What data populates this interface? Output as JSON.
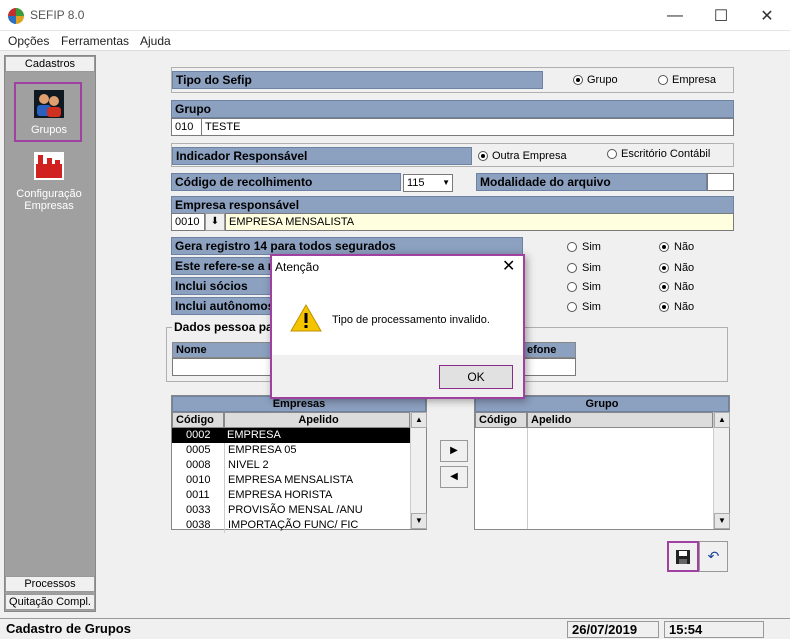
{
  "window": {
    "title": "SEFIP 8.0",
    "minimize": "—",
    "maximize": "☐",
    "close": "✕"
  },
  "menu": [
    "Opções",
    "Ferramentas",
    "Ajuda"
  ],
  "sidebar": {
    "top_tab": "Cadastros",
    "items": [
      {
        "label": "Grupos"
      },
      {
        "label": "Configuração Empresas"
      }
    ],
    "bottom_tabs": [
      "Processos",
      "Quitação Compl."
    ]
  },
  "form": {
    "tipo_sefip": {
      "label": "Tipo do Sefip",
      "options": [
        "Grupo",
        "Empresa"
      ],
      "selected": "Grupo"
    },
    "grupo": {
      "label": "Grupo",
      "code": "010",
      "name": "TESTE"
    },
    "indicador": {
      "label": "Indicador Responsável",
      "options": [
        "Outra Empresa",
        "Escritório Contábil"
      ],
      "selected": "Outra Empresa"
    },
    "codigo_recolhimento": {
      "label": "Código de recolhimento",
      "value": "115"
    },
    "modalidade": {
      "label": "Modalidade do arquivo",
      "value": ""
    },
    "empresa_resp": {
      "label": "Empresa responsável",
      "code": "0010",
      "name": "EMPRESA MENSALISTA"
    },
    "questions": [
      {
        "label": "Gera registro 14 para todos segurados",
        "sim": "Sim",
        "nao": "Não",
        "selected": "Não"
      },
      {
        "label": "Este refere-se a n",
        "sim": "Sim",
        "nao": "Não",
        "selected": "Não"
      },
      {
        "label": "Inclui sócios",
        "sim": "Sim",
        "nao": "Não",
        "selected": "Não"
      },
      {
        "label": "Inclui autônomos",
        "sim": "Sim",
        "nao": "Não",
        "selected": "Não"
      }
    ],
    "dados_pessoa": {
      "label": "Dados pessoa pa",
      "col_nome": "Nome",
      "col_fone": "efone"
    }
  },
  "empresas": {
    "title": "Empresas",
    "col_codigo": "Código",
    "col_apelido": "Apelido",
    "rows": [
      {
        "codigo": "0002",
        "apelido": "EMPRESA"
      },
      {
        "codigo": "0005",
        "apelido": "EMPRESA 05"
      },
      {
        "codigo": "0008",
        "apelido": "NIVEL 2"
      },
      {
        "codigo": "0010",
        "apelido": "EMPRESA MENSALISTA"
      },
      {
        "codigo": "0011",
        "apelido": "EMPRESA HORISTA"
      },
      {
        "codigo": "0033",
        "apelido": "PROVISÃO MENSAL /ANU"
      },
      {
        "codigo": "0038",
        "apelido": "IMPORTAÇÃO FUNC/ FIC"
      }
    ]
  },
  "grupo_grid": {
    "title": "Grupo",
    "col_codigo": "Código",
    "col_apelido": "Apelido"
  },
  "dialog": {
    "title": "Atenção",
    "message": "Tipo de processamento invalido.",
    "ok": "OK"
  },
  "status": {
    "text": "Cadastro de Grupos",
    "date": "26/07/2019",
    "time": "15:54"
  }
}
